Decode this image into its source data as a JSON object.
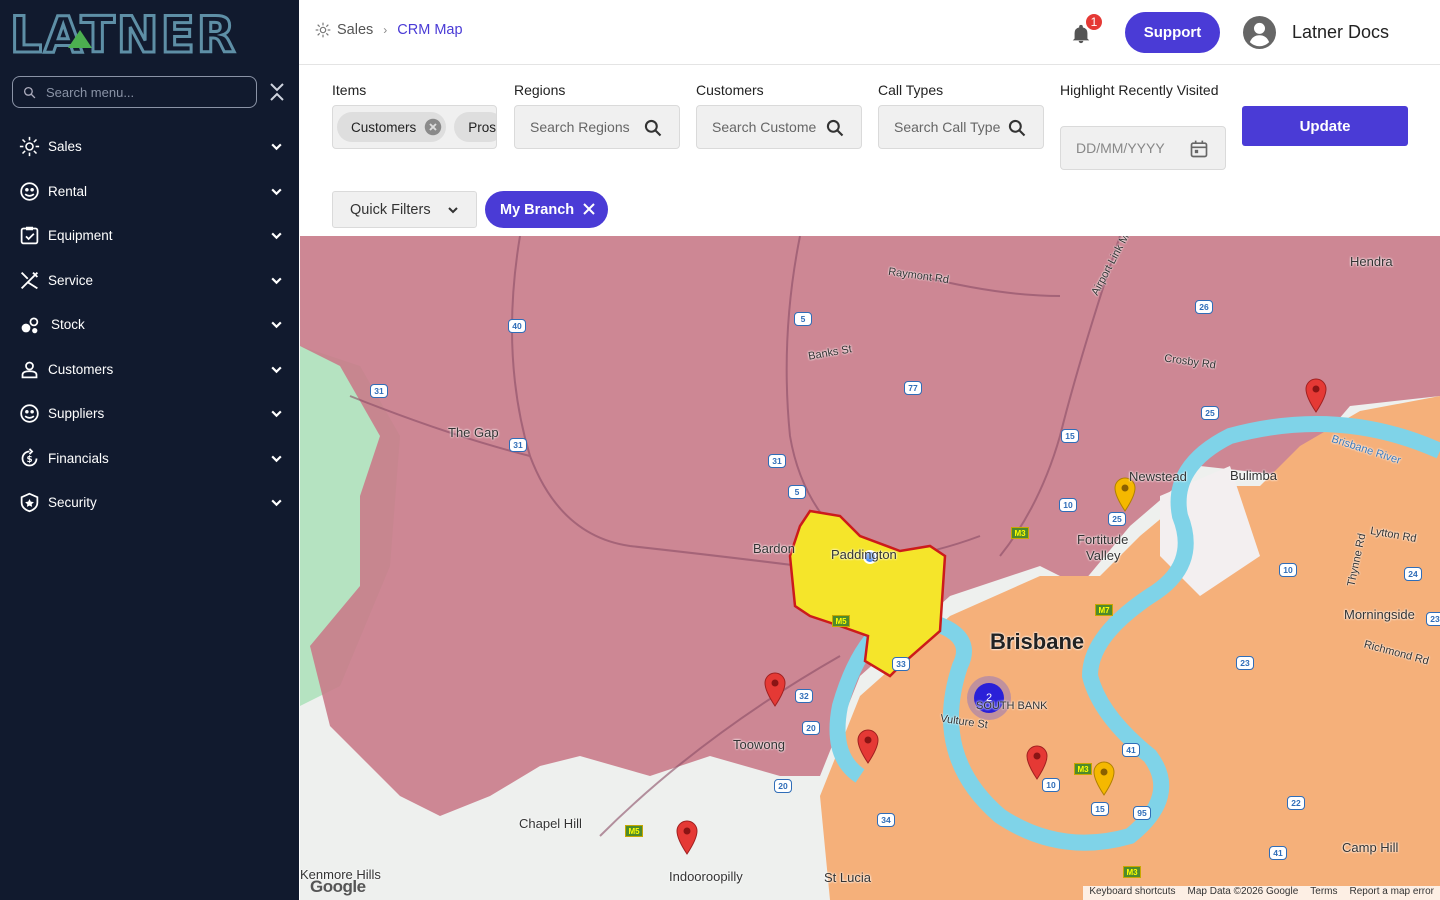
{
  "brand": {
    "logo_text": "LATNER"
  },
  "sidebar": {
    "search_placeholder": "Search menu...",
    "items": [
      {
        "label": "Sales",
        "icon": "sales-icon"
      },
      {
        "label": "Rental",
        "icon": "rental-icon"
      },
      {
        "label": "Equipment",
        "icon": "equipment-icon"
      },
      {
        "label": "Service",
        "icon": "service-icon"
      },
      {
        "label": "Stock",
        "icon": "stock-icon"
      },
      {
        "label": "Customers",
        "icon": "customers-icon"
      },
      {
        "label": "Suppliers",
        "icon": "suppliers-icon"
      },
      {
        "label": "Financials",
        "icon": "financials-icon"
      },
      {
        "label": "Security",
        "icon": "security-icon"
      }
    ]
  },
  "header": {
    "breadcrumb": [
      "Sales",
      "CRM Map"
    ],
    "notification_count": "1",
    "support_label": "Support",
    "user_name": "Latner Docs"
  },
  "filters": {
    "items_label": "Items",
    "items_chips": [
      "Customers",
      "Prosp"
    ],
    "regions_label": "Regions",
    "regions_placeholder": "Search Regions",
    "customers_label": "Customers",
    "customers_placeholder": "Search Custome",
    "call_types_label": "Call Types",
    "call_types_placeholder": "Search Call Type",
    "highlight_label": "Highlight Recently Visited",
    "date_placeholder": "DD/MM/YYYY",
    "update_label": "Update",
    "quick_filters_label": "Quick Filters",
    "my_branch_label": "My Branch"
  },
  "map": {
    "places": {
      "hendra": "Hendra",
      "the_gap": "The Gap",
      "newstead": "Newstead",
      "bulimba": "Bulimba",
      "bardon": "Bardon",
      "paddington": "Paddington",
      "fortitude_valley_1": "Fortitude",
      "fortitude_valley_2": "Valley",
      "brisbane": "Brisbane",
      "morningside": "Morningside",
      "south_bank": "SOUTH BANK",
      "toowong": "Toowong",
      "chapel_hill": "Chapel Hill",
      "camp_hill": "Camp Hill",
      "kenmore_hills": "Kenmore Hills",
      "indooroopilly": "Indooroopilly",
      "st_lucia": "St Lucia",
      "raymont_rd": "Raymont Rd",
      "banks_st": "Banks St",
      "crosby_rd": "Crosby Rd",
      "brisbane_river": "Brisbane River",
      "lytton_rd": "Lytton Rd",
      "thynne_rd": "Thynne Rd",
      "richmond_rd": "Richmond Rd",
      "vulture_st": "Vulture St",
      "airport_link": "Airport Link M7"
    },
    "cluster_count": "2",
    "google_logo": "Google",
    "attribution": [
      "Keyboard shortcuts",
      "Map Data ©2026 Google",
      "Terms",
      "Report a map error"
    ]
  },
  "colors": {
    "accent": "#4a3bd6",
    "sidebar_bg": "#111a2e",
    "region_pink": "#c97b8a",
    "region_orange": "#f5b07a",
    "region_highlight": "#f5e52a",
    "pin_red": "#e53935",
    "pin_yellow": "#f5b800"
  }
}
